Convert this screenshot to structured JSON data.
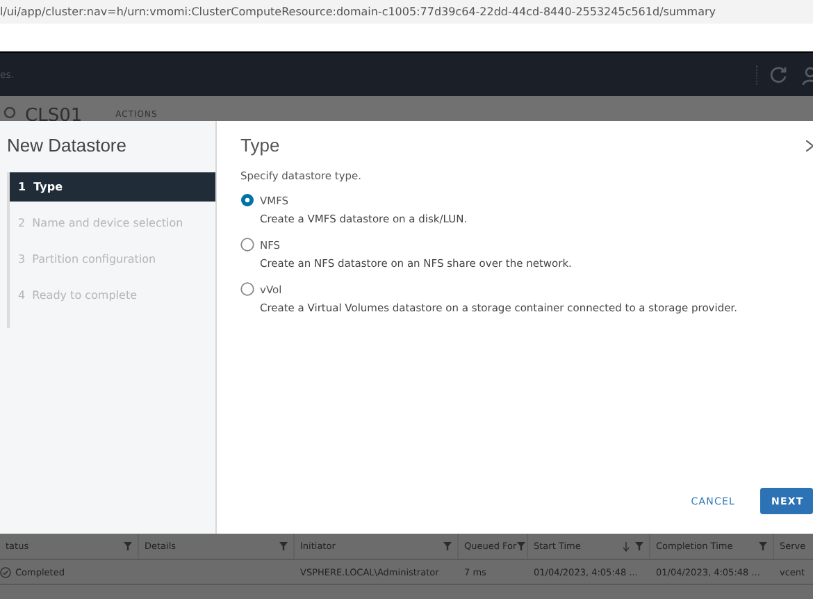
{
  "address_bar": {
    "url": "l/ui/app/cluster:nav=h/urn:vmomi:ClusterComputeResource:domain-c1005:77d39c64-22dd-44cd-8440-2553245c561d/summary"
  },
  "header": {
    "left_text": "es."
  },
  "breadcrumb": {
    "title": "CLS01",
    "actions": "ACTIONS"
  },
  "wizard": {
    "title": "New Datastore",
    "steps": [
      {
        "number": "1",
        "label": "Type",
        "selected": true
      },
      {
        "number": "2",
        "label": "Name and device selection",
        "selected": false
      },
      {
        "number": "3",
        "label": "Partition configuration",
        "selected": false
      },
      {
        "number": "4",
        "label": "Ready to complete",
        "selected": false
      }
    ],
    "page_title": "Type",
    "instruction": "Specify datastore type.",
    "options": [
      {
        "label": "VMFS",
        "description": "Create a VMFS datastore on a disk/LUN.",
        "selected": true
      },
      {
        "label": "NFS",
        "description": "Create an NFS datastore on an NFS share over the network.",
        "selected": false
      },
      {
        "label": "vVol",
        "description": "Create a Virtual Volumes datastore on a storage container connected to a storage provider.",
        "selected": false
      }
    ],
    "buttons": [
      {
        "kind": "flat",
        "label": "CANCEL"
      },
      {
        "kind": "primary",
        "label": "NEXT"
      }
    ]
  },
  "tasks_table": {
    "columns": [
      {
        "label": "tatus",
        "sorted": false
      },
      {
        "label": "Details",
        "sorted": false
      },
      {
        "label": "Initiator",
        "sorted": false
      },
      {
        "label": "Queued For",
        "sorted": false
      },
      {
        "label": "Start Time",
        "sorted": true
      },
      {
        "label": "Completion Time",
        "sorted": false
      },
      {
        "label": "Serve",
        "sorted": false
      }
    ],
    "rows": [
      [
        "Completed",
        "",
        "VSPHERE.LOCAL\\Administrator",
        "7 ms",
        "01/04/2023, 4:05:48 ...",
        "01/04/2023, 4:05:48 ...",
        "vcent"
      ]
    ]
  }
}
